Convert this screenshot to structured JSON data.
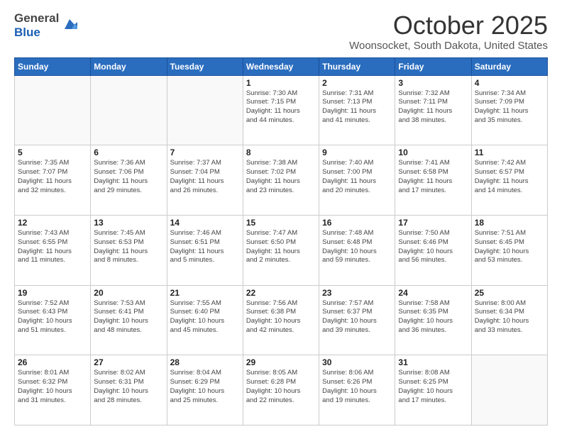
{
  "header": {
    "logo_general": "General",
    "logo_blue": "Blue",
    "month": "October 2025",
    "location": "Woonsocket, South Dakota, United States"
  },
  "days_of_week": [
    "Sunday",
    "Monday",
    "Tuesday",
    "Wednesday",
    "Thursday",
    "Friday",
    "Saturday"
  ],
  "weeks": [
    [
      {
        "day": "",
        "info": ""
      },
      {
        "day": "",
        "info": ""
      },
      {
        "day": "",
        "info": ""
      },
      {
        "day": "1",
        "info": "Sunrise: 7:30 AM\nSunset: 7:15 PM\nDaylight: 11 hours\nand 44 minutes."
      },
      {
        "day": "2",
        "info": "Sunrise: 7:31 AM\nSunset: 7:13 PM\nDaylight: 11 hours\nand 41 minutes."
      },
      {
        "day": "3",
        "info": "Sunrise: 7:32 AM\nSunset: 7:11 PM\nDaylight: 11 hours\nand 38 minutes."
      },
      {
        "day": "4",
        "info": "Sunrise: 7:34 AM\nSunset: 7:09 PM\nDaylight: 11 hours\nand 35 minutes."
      }
    ],
    [
      {
        "day": "5",
        "info": "Sunrise: 7:35 AM\nSunset: 7:07 PM\nDaylight: 11 hours\nand 32 minutes."
      },
      {
        "day": "6",
        "info": "Sunrise: 7:36 AM\nSunset: 7:06 PM\nDaylight: 11 hours\nand 29 minutes."
      },
      {
        "day": "7",
        "info": "Sunrise: 7:37 AM\nSunset: 7:04 PM\nDaylight: 11 hours\nand 26 minutes."
      },
      {
        "day": "8",
        "info": "Sunrise: 7:38 AM\nSunset: 7:02 PM\nDaylight: 11 hours\nand 23 minutes."
      },
      {
        "day": "9",
        "info": "Sunrise: 7:40 AM\nSunset: 7:00 PM\nDaylight: 11 hours\nand 20 minutes."
      },
      {
        "day": "10",
        "info": "Sunrise: 7:41 AM\nSunset: 6:58 PM\nDaylight: 11 hours\nand 17 minutes."
      },
      {
        "day": "11",
        "info": "Sunrise: 7:42 AM\nSunset: 6:57 PM\nDaylight: 11 hours\nand 14 minutes."
      }
    ],
    [
      {
        "day": "12",
        "info": "Sunrise: 7:43 AM\nSunset: 6:55 PM\nDaylight: 11 hours\nand 11 minutes."
      },
      {
        "day": "13",
        "info": "Sunrise: 7:45 AM\nSunset: 6:53 PM\nDaylight: 11 hours\nand 8 minutes."
      },
      {
        "day": "14",
        "info": "Sunrise: 7:46 AM\nSunset: 6:51 PM\nDaylight: 11 hours\nand 5 minutes."
      },
      {
        "day": "15",
        "info": "Sunrise: 7:47 AM\nSunset: 6:50 PM\nDaylight: 11 hours\nand 2 minutes."
      },
      {
        "day": "16",
        "info": "Sunrise: 7:48 AM\nSunset: 6:48 PM\nDaylight: 10 hours\nand 59 minutes."
      },
      {
        "day": "17",
        "info": "Sunrise: 7:50 AM\nSunset: 6:46 PM\nDaylight: 10 hours\nand 56 minutes."
      },
      {
        "day": "18",
        "info": "Sunrise: 7:51 AM\nSunset: 6:45 PM\nDaylight: 10 hours\nand 53 minutes."
      }
    ],
    [
      {
        "day": "19",
        "info": "Sunrise: 7:52 AM\nSunset: 6:43 PM\nDaylight: 10 hours\nand 51 minutes."
      },
      {
        "day": "20",
        "info": "Sunrise: 7:53 AM\nSunset: 6:41 PM\nDaylight: 10 hours\nand 48 minutes."
      },
      {
        "day": "21",
        "info": "Sunrise: 7:55 AM\nSunset: 6:40 PM\nDaylight: 10 hours\nand 45 minutes."
      },
      {
        "day": "22",
        "info": "Sunrise: 7:56 AM\nSunset: 6:38 PM\nDaylight: 10 hours\nand 42 minutes."
      },
      {
        "day": "23",
        "info": "Sunrise: 7:57 AM\nSunset: 6:37 PM\nDaylight: 10 hours\nand 39 minutes."
      },
      {
        "day": "24",
        "info": "Sunrise: 7:58 AM\nSunset: 6:35 PM\nDaylight: 10 hours\nand 36 minutes."
      },
      {
        "day": "25",
        "info": "Sunrise: 8:00 AM\nSunset: 6:34 PM\nDaylight: 10 hours\nand 33 minutes."
      }
    ],
    [
      {
        "day": "26",
        "info": "Sunrise: 8:01 AM\nSunset: 6:32 PM\nDaylight: 10 hours\nand 31 minutes."
      },
      {
        "day": "27",
        "info": "Sunrise: 8:02 AM\nSunset: 6:31 PM\nDaylight: 10 hours\nand 28 minutes."
      },
      {
        "day": "28",
        "info": "Sunrise: 8:04 AM\nSunset: 6:29 PM\nDaylight: 10 hours\nand 25 minutes."
      },
      {
        "day": "29",
        "info": "Sunrise: 8:05 AM\nSunset: 6:28 PM\nDaylight: 10 hours\nand 22 minutes."
      },
      {
        "day": "30",
        "info": "Sunrise: 8:06 AM\nSunset: 6:26 PM\nDaylight: 10 hours\nand 19 minutes."
      },
      {
        "day": "31",
        "info": "Sunrise: 8:08 AM\nSunset: 6:25 PM\nDaylight: 10 hours\nand 17 minutes."
      },
      {
        "day": "",
        "info": ""
      }
    ]
  ]
}
